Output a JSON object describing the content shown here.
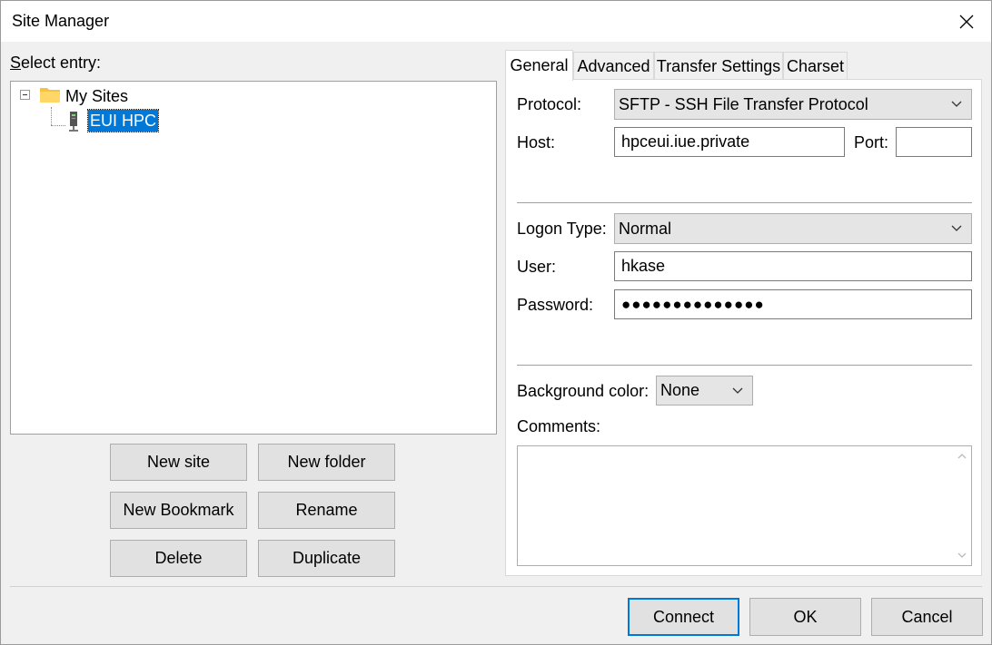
{
  "window": {
    "title": "Site Manager"
  },
  "left": {
    "select_entry_label": "Select entry:",
    "tree": {
      "root_label": "My Sites",
      "child_label": "EUI HPC"
    },
    "buttons": {
      "new_site": "New site",
      "new_folder": "New folder",
      "new_bookmark": "New Bookmark",
      "rename": "Rename",
      "delete": "Delete",
      "duplicate": "Duplicate"
    }
  },
  "tabs": [
    "General",
    "Advanced",
    "Transfer Settings",
    "Charset"
  ],
  "general": {
    "protocol_label": "Protocol:",
    "protocol_value": "SFTP - SSH File Transfer Protocol",
    "host_label": "Host:",
    "host_value": "hpceui.iue.private",
    "port_label": "Port:",
    "port_value": "",
    "logon_type_label": "Logon Type:",
    "logon_type_value": "Normal",
    "user_label": "User:",
    "user_value": "hkase",
    "password_label": "Password:",
    "password_value": "●●●●●●●●●●●●●●",
    "bgcolor_label": "Background color:",
    "bgcolor_value": "None",
    "comments_label": "Comments:"
  },
  "footer": {
    "connect": "Connect",
    "ok": "OK",
    "cancel": "Cancel"
  },
  "colors": {
    "selection": "#0078d7",
    "button_face": "#e1e1e1",
    "window_bg": "#f0f0f0"
  }
}
